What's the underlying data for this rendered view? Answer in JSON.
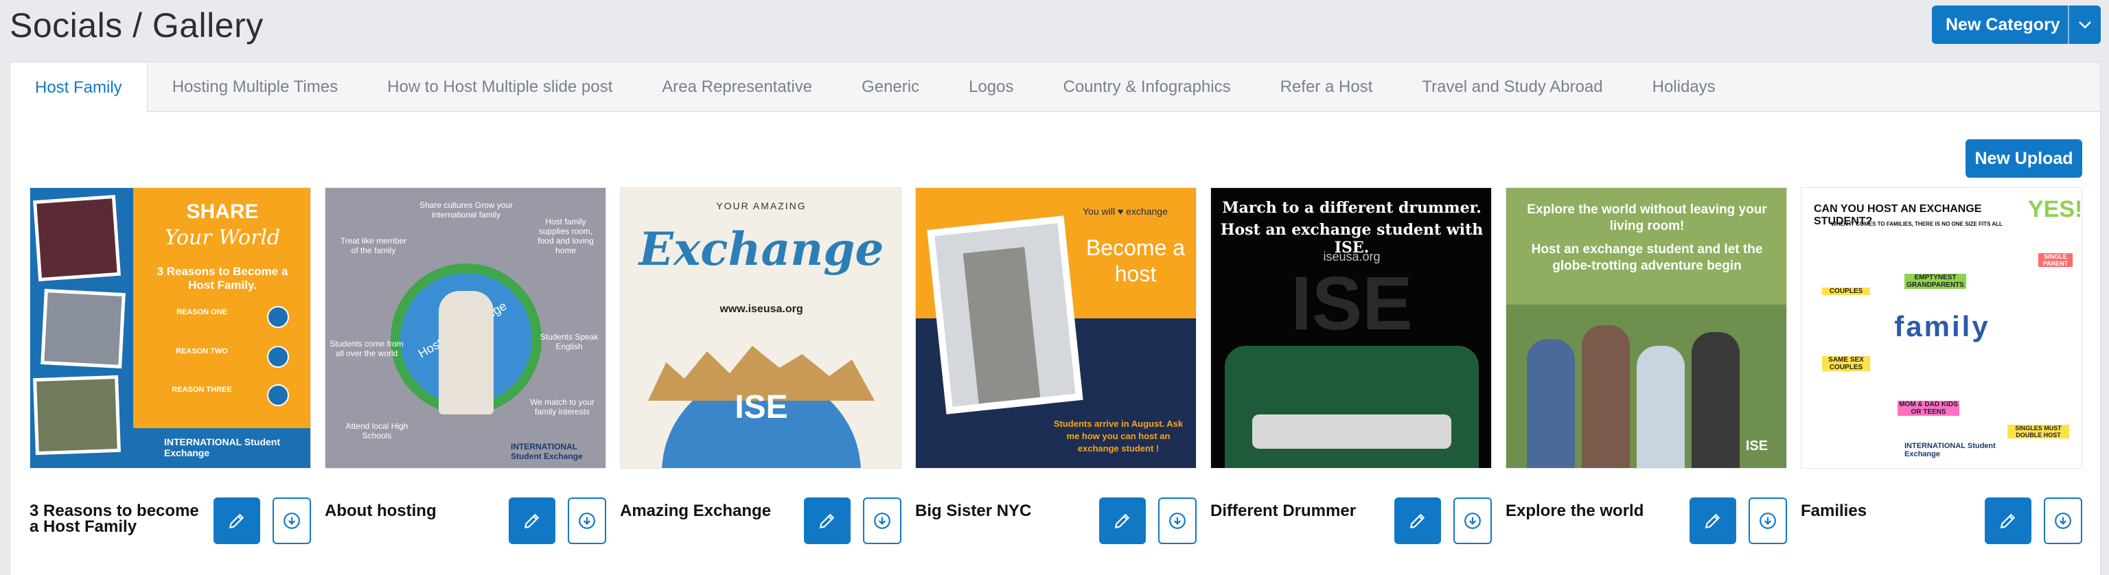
{
  "page": {
    "title": "Socials / Gallery"
  },
  "header": {
    "new_category_label": "New Category"
  },
  "tabs": [
    {
      "label": "Host Family",
      "active": true
    },
    {
      "label": "Hosting Multiple Times"
    },
    {
      "label": "How to Host Multiple slide post"
    },
    {
      "label": "Area Representative"
    },
    {
      "label": "Generic"
    },
    {
      "label": "Logos"
    },
    {
      "label": "Country & Infographics"
    },
    {
      "label": "Refer a Host"
    },
    {
      "label": "Travel and Study Abroad"
    },
    {
      "label": "Holidays"
    }
  ],
  "toolbar": {
    "new_upload_label": "New Upload"
  },
  "colors": {
    "accent": "#1178c6",
    "tab_inactive": "#7b8189",
    "background": "#e8eaee"
  },
  "icons": {
    "edit": "pencil-icon",
    "download": "download-circle-icon",
    "dropdown": "chevron-down-icon"
  },
  "gallery": [
    {
      "title": "3 Reasons to become a Host Family",
      "image_text": {
        "share": "SHARE",
        "your_world": "Your World",
        "heading": "3 Reasons to Become a Host Family.",
        "r1": "REASON ONE",
        "r2": "REASON TWO",
        "r3": "REASON THREE",
        "brand": "INTERNATIONAL Student Exchange"
      }
    },
    {
      "title": "About hosting",
      "image_text": {
        "ring": "Host an exchange student",
        "l1": "Share cultures Grow your international family",
        "l2": "Treat like member of the family",
        "l3": "Host family supplies room, food and loving home",
        "l4": "Students come from all over the world",
        "l5": "Students Speak English",
        "l6": "Attend local High Schools",
        "l7": "We match to your family interests",
        "brand": "INTERNATIONAL Student Exchange"
      }
    },
    {
      "title": "Amazing Exchange",
      "image_text": {
        "your_amazing": "YOUR AMAZING",
        "exchange": "Exchange",
        "site": "www.iseusa.org",
        "logo": "ISE"
      }
    },
    {
      "title": "Big Sister NYC",
      "image_text": {
        "you_will": "You will ♥ exchange",
        "become": "Become a host",
        "arrive": "Students arrive in August. Ask me how you can host an exchange student !"
      }
    },
    {
      "title": "Different Drummer",
      "image_text": {
        "line1": "March to a different drummer.",
        "line2": "Host an exchange student with ISE.",
        "site": "iseusa.org",
        "logo": "ISE"
      }
    },
    {
      "title": "Explore the world",
      "image_text": {
        "line1": "Explore the world without leaving your living room!",
        "line2": "Host an exchange student and let the globe-trotting adventure begin",
        "logo": "ISE"
      }
    },
    {
      "title": "Families",
      "image_text": {
        "question": "CAN YOU HOST AN EXCHANGE STUDENT?",
        "yes": "YES!",
        "sub": "WHEN IT COMES TO FAMILIES, THERE IS NO ONE SIZE FITS ALL",
        "family": "family",
        "t1": "COUPLES",
        "t2": "EMPTYNEST GRANDPARENTS",
        "t3": "SINGLE PARENT",
        "t4": "SAME SEX COUPLES",
        "t5": "MOM & DAD KIDS OR TEENS",
        "t6": "SINGLES MUST DOUBLE HOST",
        "brand": "INTERNATIONAL Student Exchange"
      }
    }
  ]
}
